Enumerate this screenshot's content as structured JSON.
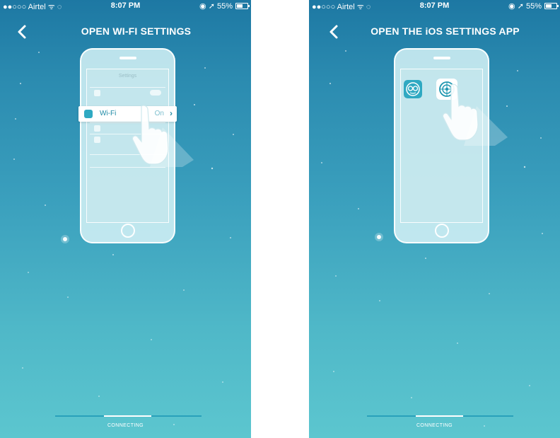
{
  "status_bar_left": {
    "carrier": "●●○○○ Airtel ᯤ ◌",
    "time": "8:07 PM",
    "right": "◉ ➚ 55%"
  },
  "status_bar_right": {
    "carrier": "●●○○○ Airtel ᯤ ◌",
    "time": "8:07 PM",
    "right": "◉ ➚ 55%"
  },
  "left_screen": {
    "title": "OPEN WI-FI SETTINGS",
    "settings": {
      "wifi_label": "Wi-Fi",
      "wifi_value": "On",
      "wifi_chevron": "›"
    },
    "progress_label": "CONNECTING",
    "progress_fraction": 0.33
  },
  "right_screen": {
    "title": "OPEN THE iOS SETTINGS APP",
    "progress_label": "CONNECTING",
    "progress_fraction": 0.33
  },
  "icons": {
    "back": "chevron-left-icon",
    "wifi": "wifi-icon",
    "app": "robot-face-app-icon",
    "settings": "settings-gear-icon",
    "hand": "pointing-hand-icon"
  },
  "colors": {
    "gradient_top": "#1d78a3",
    "gradient_bottom": "#5cc6cf",
    "accent": "#2fa9c2",
    "text": "#ffffff"
  }
}
